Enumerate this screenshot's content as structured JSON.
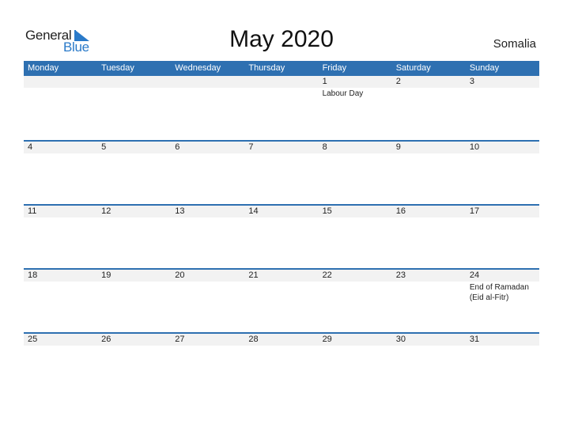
{
  "logo": {
    "word1": "General",
    "word2": "Blue"
  },
  "title": "May 2020",
  "country": "Somalia",
  "colors": {
    "header_bg": "#2e70b1",
    "date_strip_bg": "#f2f2f2",
    "logo_blue": "#2a7ac9"
  },
  "weekdays": [
    "Monday",
    "Tuesday",
    "Wednesday",
    "Thursday",
    "Friday",
    "Saturday",
    "Sunday"
  ],
  "weeks": [
    {
      "dates": [
        "",
        "",
        "",
        "",
        "1",
        "2",
        "3"
      ],
      "events": [
        "",
        "",
        "",
        "",
        "Labour Day",
        "",
        ""
      ]
    },
    {
      "dates": [
        "4",
        "5",
        "6",
        "7",
        "8",
        "9",
        "10"
      ],
      "events": [
        "",
        "",
        "",
        "",
        "",
        "",
        ""
      ]
    },
    {
      "dates": [
        "11",
        "12",
        "13",
        "14",
        "15",
        "16",
        "17"
      ],
      "events": [
        "",
        "",
        "",
        "",
        "",
        "",
        ""
      ]
    },
    {
      "dates": [
        "18",
        "19",
        "20",
        "21",
        "22",
        "23",
        "24"
      ],
      "events": [
        "",
        "",
        "",
        "",
        "",
        "",
        "End of Ramadan (Eid al-Fitr)"
      ]
    },
    {
      "dates": [
        "25",
        "26",
        "27",
        "28",
        "29",
        "30",
        "31"
      ],
      "events": [
        "",
        "",
        "",
        "",
        "",
        "",
        ""
      ]
    }
  ]
}
